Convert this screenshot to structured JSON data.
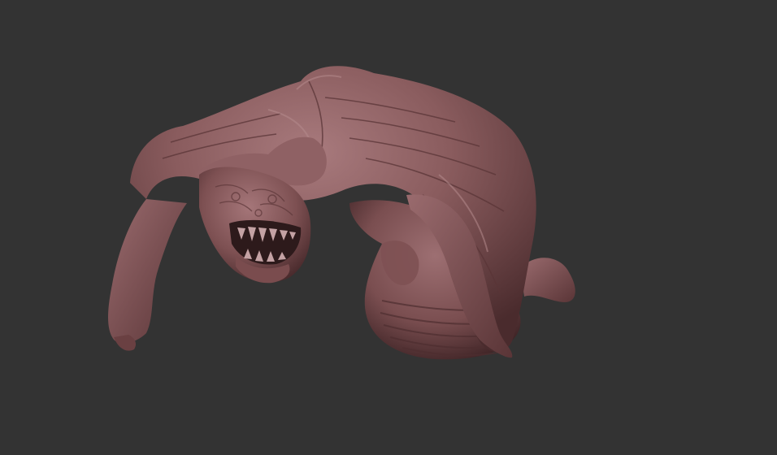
{
  "scene": {
    "background_color": "#333333",
    "subject": {
      "name": "creature-sculpt",
      "base_color": "#8a5c5e",
      "highlight_color": "#b08286",
      "shadow_color": "#3e2426"
    }
  }
}
